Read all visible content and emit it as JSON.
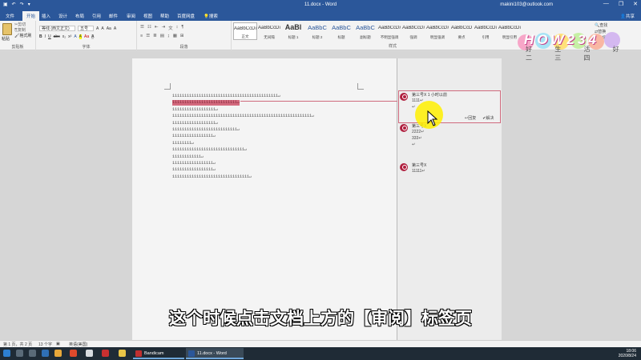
{
  "window": {
    "title": "11.docx - Word",
    "account": "makini103@outlook.com",
    "qat": [
      "↶",
      "↷",
      "▾"
    ],
    "controls": [
      "—",
      "❐",
      "✕"
    ]
  },
  "tabs": [
    "文件",
    "开始",
    "插入",
    "设计",
    "布局",
    "引用",
    "邮件",
    "审阅",
    "视图",
    "帮助",
    "百度网盘",
    "搜索"
  ],
  "share_label": "共享",
  "ribbon": {
    "clipboard": {
      "paste_label": "粘贴",
      "cut": "剪切",
      "copy": "复制",
      "format_painter": "格式刷",
      "group_label": "剪贴板"
    },
    "font": {
      "font_name": "等线 (西文正文)",
      "font_size": "五号",
      "group_label": "字体",
      "row2": [
        "B",
        "I",
        "U",
        "abc",
        "x₂",
        "x²",
        "A",
        "A",
        "Aa",
        "A"
      ]
    },
    "paragraph": {
      "group_label": "段落",
      "row1": [
        "☰",
        "☷",
        "⇤",
        "⇥",
        "文",
        "↕",
        "¶"
      ],
      "row2": [
        "≡",
        "☰",
        "≣",
        "▤",
        "↨",
        "▦",
        "⊞"
      ]
    },
    "styles": {
      "group_label": "样式",
      "items": [
        {
          "sample": "AaBbCcDı",
          "name": "正文",
          "size": "s"
        },
        {
          "sample": "AaBbCcDı",
          "name": "无间隔",
          "size": "s"
        },
        {
          "sample": "AaBl",
          "name": "标题 1",
          "size": "big"
        },
        {
          "sample": "AaBbC",
          "name": "标题 2",
          "size": "mid"
        },
        {
          "sample": "AaBbC",
          "name": "标题",
          "size": "mid"
        },
        {
          "sample": "AaBbC",
          "name": "副标题",
          "size": "mid"
        },
        {
          "sample": "AaBbCcDı",
          "name": "不明显强调",
          "size": "s"
        },
        {
          "sample": "AaBbCcDı",
          "name": "强调",
          "size": "s"
        },
        {
          "sample": "AaBbCcDı",
          "name": "明显强调",
          "size": "s"
        },
        {
          "sample": "AaBbCcD",
          "name": "要点",
          "size": "s"
        },
        {
          "sample": "AaBbCcDı",
          "name": "引用",
          "size": "s"
        },
        {
          "sample": "AaBbCcDı",
          "name": "明显引用",
          "size": "s"
        }
      ]
    },
    "editing": {
      "find": "查找",
      "replace": "替换",
      "select": "选择",
      "group_label": "编辑"
    }
  },
  "document_lines": [
    "11111111111111111111111111111111111111111111↵",
    "111111111111111111111111111↵",
    "111111111111111111↵",
    "1111111111111111111111111111111111111111111111111111111111↵",
    "111111111111111111↵",
    "111111111111111111111111111↵",
    "11111111111111111↵",
    "11111111↵",
    "111111111111111111111111111111↵",
    "111111111111↵",
    "11111111111111111↵",
    "11111111111111111↵",
    "11111111111111111111111111111111↵"
  ],
  "comments": [
    {
      "author": "第三号X",
      "time": "1 小时以前",
      "lines": [
        "1111↵",
        "↵"
      ],
      "actions": [
        "回复",
        "解决"
      ]
    },
    {
      "author": "第三号X",
      "time": "",
      "lines": [
        "2222↵",
        "333↵",
        "↵"
      ],
      "actions": []
    },
    {
      "author": "第三号X",
      "time": "",
      "lines": [
        "11111↵"
      ],
      "actions": []
    }
  ],
  "subtitle": "这个时候点击文档上方的【审阅】标签页",
  "watermark": {
    "logo_text": "HOW234",
    "tagline": "好 生 活 好 二 三 四"
  },
  "statusbar": {
    "page": "第 1 页，共 2 页",
    "words": "13 个字",
    "lang": "英语(美国)"
  },
  "taskbar": {
    "apps": [
      "Bandicam",
      "11.docx - Word"
    ],
    "time": "18:06",
    "date": "2020/8/24"
  },
  "colors": {
    "word_blue": "#2b579a",
    "comment_red": "#cf6a7d",
    "avatar": "#b0203f",
    "highlight": "#ffee00"
  }
}
